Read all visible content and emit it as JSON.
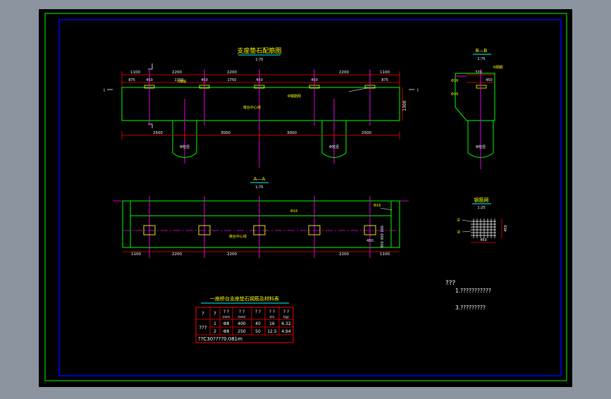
{
  "colors": {
    "background": "#8c94a0",
    "sheet": "#000000",
    "outer_frame": "#00ff00",
    "inner_frame": "#0000ff",
    "structure": "#00ff00",
    "dimension": "#ff0000",
    "axis": "#ff00ff",
    "text": "#ffff00",
    "white": "#ffffff",
    "underline": "#00ffff"
  },
  "elevation": {
    "title": "支座垫石配筋图",
    "scale": "1:75",
    "top_dims": [
      "1100",
      "2200",
      "2200",
      "2200",
      "1100"
    ],
    "pad_dims": [
      "875",
      "450",
      "1750",
      "450",
      "450",
      "1750",
      "450",
      "875"
    ],
    "bottom_dims": [
      "2500",
      "3000",
      "3000",
      "2500"
    ],
    "height_dim": "1300",
    "pier_label_left": "Φ柱径",
    "pier_label_right": "Φ柱径",
    "note_rebar": "Φ钢筋网",
    "note_axis": "墩台中心线",
    "note_top": "N钢筋",
    "section_mark_left": "I",
    "section_mark_right": "I"
  },
  "section_bb": {
    "title": "B—B",
    "scale": "1:75",
    "dim_top": "370",
    "dim_pad": "450",
    "label_a": "Φ16",
    "label_b": "Φ16",
    "label_c": "N钢筋",
    "label_pier": "Φ柱径"
  },
  "plan": {
    "title": "A—A",
    "scale": "1:75",
    "dims": [
      "1100",
      "2200",
      "2200",
      "2200",
      "1100"
    ],
    "pad_dim": "450",
    "side_dims": "450 300 100",
    "label_a": "Φ16",
    "label_b": "Φ16",
    "label_axis": "墩台中心线"
  },
  "mesh_detail": {
    "title": "钢筋网",
    "scale": "1:25",
    "marks": [
      "①",
      "②"
    ],
    "dim_side": "450",
    "dim_bottom": "450"
  },
  "table": {
    "title": "一座桥台支座垫石钢筋及材料表",
    "headers": [
      "?",
      "?",
      "? ?",
      "? ?",
      "? ?",
      "? ?",
      "? ?"
    ],
    "subheaders": [
      "(mm)",
      "(mm)",
      "",
      "(m)",
      "(kg)"
    ],
    "row_group": "???",
    "rows": [
      {
        "no": "1",
        "dia": "Φ8",
        "len": "400",
        "count": "40",
        "total": "16",
        "weight": "6.32"
      },
      {
        "no": "2",
        "dia": "Φ8",
        "len": "250",
        "count": "50",
        "total": "12.5",
        "weight": "4.94"
      }
    ],
    "footer": "??C30????0.081m"
  },
  "notes": {
    "heading": "???",
    "items": [
      "1.???????????",
      "3.?????????"
    ]
  }
}
